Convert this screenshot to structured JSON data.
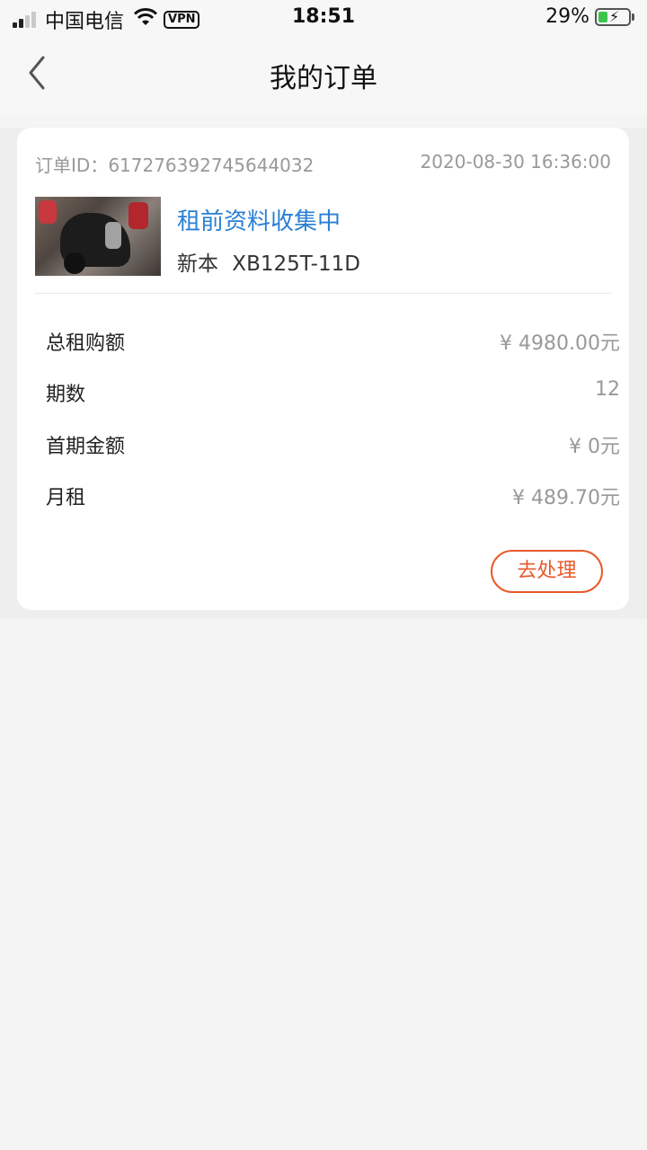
{
  "status_bar": {
    "carrier": "中国电信",
    "vpn": "VPN",
    "time": "18:51",
    "battery": "29%",
    "icons": [
      "signal-icon",
      "wifi-icon",
      "battery-icon"
    ]
  },
  "nav": {
    "title": "我的订单",
    "back_icon": "chevron-left-icon"
  },
  "order": {
    "id_label": "订单ID：",
    "id_value": "617276392745644032",
    "date": "2020-08-30 16:36:00",
    "status": "租前资料收集中",
    "model": "新本  XB125T-11D",
    "rows": [
      {
        "label": "总租购额",
        "value": "¥ 4980.00元"
      },
      {
        "label": "期数",
        "value": "12"
      },
      {
        "label": "首期金额",
        "value": "¥ 0元"
      },
      {
        "label": "月租",
        "value": "¥ 489.70元"
      }
    ],
    "action_label": "去处理"
  },
  "colors": {
    "status_blue": "#2a7fd4",
    "action_orange": "#e85a2c",
    "muted_gray": "#999999"
  }
}
